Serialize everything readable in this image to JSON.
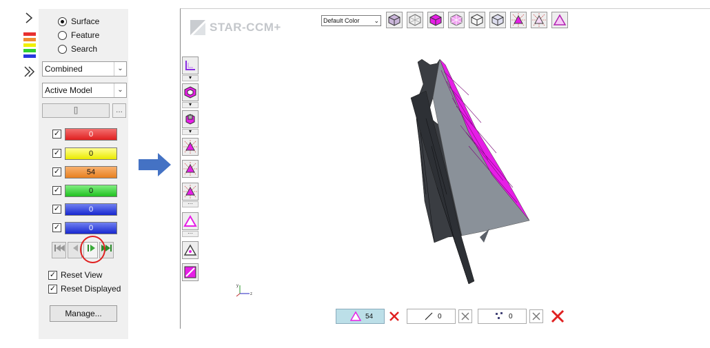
{
  "left_panel": {
    "radios": [
      {
        "label": "Surface",
        "selected": true
      },
      {
        "label": "Feature",
        "selected": false
      },
      {
        "label": "Search",
        "selected": false
      }
    ],
    "combo1": "Combined",
    "combo2": "Active Model",
    "filter_field": "[]",
    "filter_button": "...",
    "counters": [
      {
        "value": "0",
        "color": "#e83030"
      },
      {
        "value": "0",
        "color": "#f0f000"
      },
      {
        "value": "54",
        "color": "#f08c30"
      },
      {
        "value": "0",
        "color": "#30d030"
      },
      {
        "value": "0",
        "color": "#2838e0"
      },
      {
        "value": "0",
        "color": "#2838e0"
      }
    ],
    "reset_view": "Reset View",
    "reset_displayed": "Reset Displayed",
    "manage": "Manage..."
  },
  "viewer": {
    "logo": "STAR-CCM+",
    "color_select": "Default Color",
    "triangle_count": "54",
    "edge_count": "0",
    "vertex_count": "0"
  },
  "colors": {
    "selected_face": "#e61ee6",
    "mesh_dark": "#3a3d42",
    "mesh_grey": "#8a9199",
    "arrow": "#4472c4"
  }
}
